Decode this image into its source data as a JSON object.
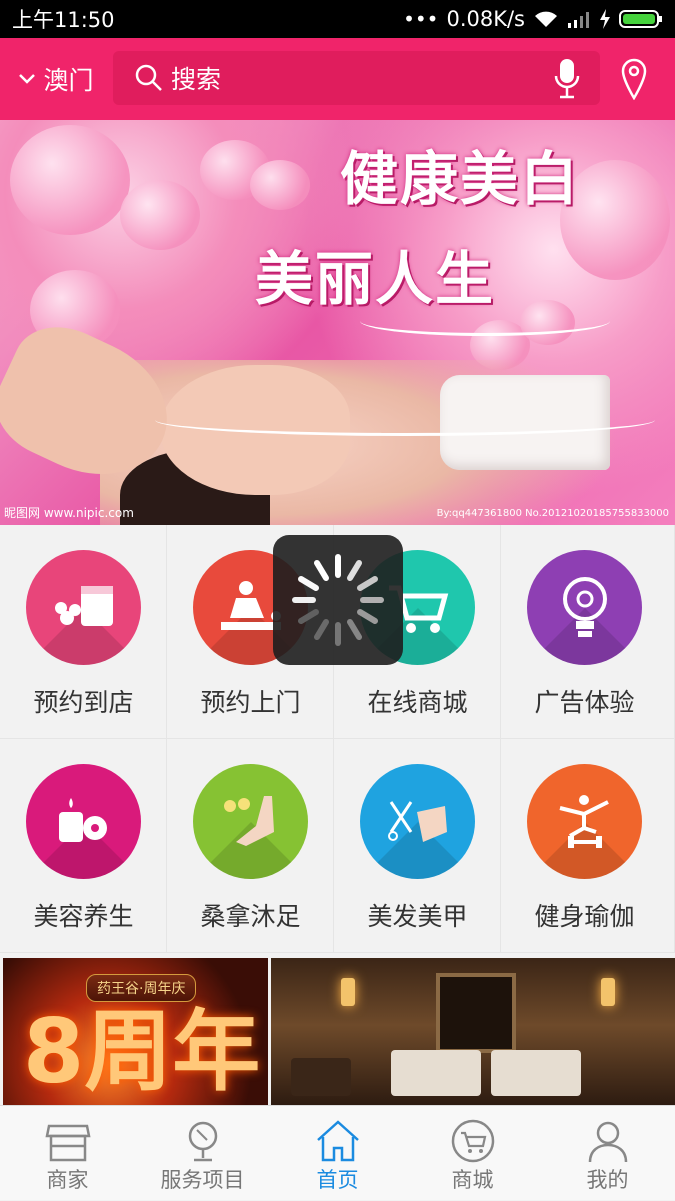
{
  "status_bar": {
    "time": "上午11:50",
    "network_speed": "0.08K/s"
  },
  "header": {
    "city": "澳门",
    "search_placeholder": "搜索"
  },
  "banner": {
    "title_line1": "健康美白",
    "title_line2": "美丽人生",
    "watermark_left": "昵图网 www.nipic.com",
    "watermark_right": "By:qq447361800 No.20121020185755833000"
  },
  "services": [
    {
      "label": "预约到店",
      "icon": "cosmetics-icon",
      "color": "#e8457a"
    },
    {
      "label": "预约上门",
      "icon": "massage-icon",
      "color": "#e84a3c"
    },
    {
      "label": "在线商城",
      "icon": "cart-icon",
      "color": "#1fc7ad"
    },
    {
      "label": "广告体验",
      "icon": "lightbulb-icon",
      "color": "#8e3fb3"
    },
    {
      "label": "美容养生",
      "icon": "candle-icon",
      "color": "#d91a7b"
    },
    {
      "label": "桑拿沐足",
      "icon": "foot-icon",
      "color": "#86c233"
    },
    {
      "label": "美发美甲",
      "icon": "nails-icon",
      "color": "#1fa3e0"
    },
    {
      "label": "健身瑜伽",
      "icon": "yoga-icon",
      "color": "#f0652c"
    }
  ],
  "promo": {
    "badge_text": "药王谷·周年庆",
    "big_text": "8周年"
  },
  "tabbar": {
    "active_index": 2,
    "items": [
      {
        "label": "商家",
        "icon": "store-icon"
      },
      {
        "label": "服务项目",
        "icon": "mirror-icon"
      },
      {
        "label": "首页",
        "icon": "home-icon"
      },
      {
        "label": "商城",
        "icon": "cart-icon"
      },
      {
        "label": "我的",
        "icon": "user-icon"
      }
    ]
  },
  "colors": {
    "brand": "#f0246a",
    "tab_active": "#1b8be0"
  }
}
